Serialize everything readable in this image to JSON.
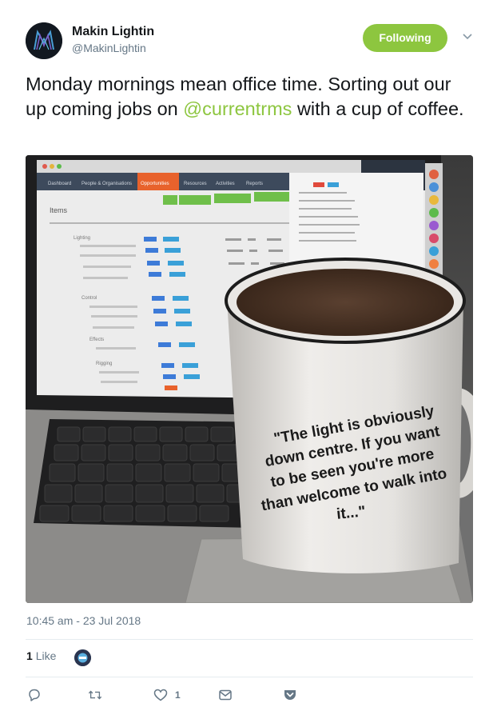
{
  "author": {
    "display_name": "Makin Lightin",
    "handle": "@MakinLightin",
    "avatar_icon": "ml-logo-icon",
    "avatar_letters": "ML"
  },
  "follow_button": {
    "label": "Following",
    "color": "#8dc63f"
  },
  "tweet": {
    "text_before": "Monday mornings mean office time. Sorting out our up coming jobs on ",
    "mention": "@currentrms",
    "text_after": " with a cup of coffee.",
    "mention_color": "#8dc63f"
  },
  "photo": {
    "description_icon": "laptop-and-mug-photo",
    "mug_quote_lines": [
      "\"The light is obviously",
      "down centre. If you want",
      "to be seen you're more",
      "than welcome to walk into",
      "it...\""
    ],
    "screen_text": {
      "tab_dashboard": "Dashboard",
      "tab_people": "People & Organisations",
      "tab_opportunities": "Opportunities",
      "tab_resources": "Resources",
      "tab_activities": "Activities",
      "tab_reports": "Reports",
      "items_heading": "Items",
      "section_lighting": "Lighting",
      "section_control": "Control",
      "section_effects": "Effects",
      "section_rigging": "Rigging"
    }
  },
  "timestamp": "10:45 am - 23 Jul 2018",
  "likes": {
    "count": "1",
    "label": "Like"
  },
  "actions": {
    "reply_icon": "reply-icon",
    "retweet_icon": "retweet-icon",
    "like_icon": "heart-icon",
    "like_count": "1",
    "dm_icon": "envelope-icon",
    "more_icon": "pocket-icon"
  }
}
